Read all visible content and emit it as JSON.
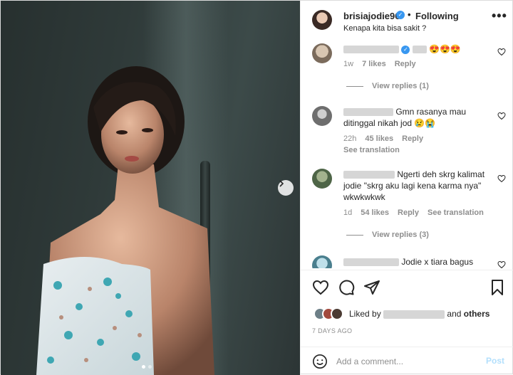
{
  "post": {
    "author": "brisiajodie96",
    "follow_state": "Following",
    "separator": "•",
    "more_glyph": "•••",
    "caption": "Kenapa kita bisa sakit ?"
  },
  "comments": [
    {
      "text_emoji": "😍😍😍",
      "age": "1w",
      "likes": "7 likes",
      "reply": "Reply",
      "view_replies": "View replies (1)"
    },
    {
      "text": "Gmn rasanya mau ditinggal nikah jod",
      "text_emoji": "😢😭",
      "age": "22h",
      "likes": "45 likes",
      "reply": "Reply",
      "see_translation": "See translation"
    },
    {
      "text": "Ngerti deh skrg kalimat jodie \"skrg aku lagi kena karma nya\" wkwkwkwk",
      "age": "1d",
      "likes": "54 likes",
      "reply": "Reply",
      "see_translation": "See translation",
      "view_replies": "View replies (3)"
    },
    {
      "text": "Jodie x tiara bagus"
    }
  ],
  "likes_summary": {
    "prefix": "Liked by",
    "conjunction": "and",
    "others": "others"
  },
  "date": "7 DAYS AGO",
  "add_comment": {
    "placeholder": "Add a comment...",
    "post_label": "Post"
  },
  "icons": {
    "verified": "verified-badge-icon",
    "next": "chevron-right-icon",
    "like": "heart-icon",
    "comment": "comment-bubble-icon",
    "share": "paper-plane-icon",
    "save": "bookmark-icon",
    "emoji": "smiley-icon"
  },
  "colors": {
    "verified": "#3897f0",
    "post_disabled": "#b2dffc",
    "muted": "#8e8e8e",
    "text": "#262626"
  },
  "carousel": {
    "total": 2,
    "current": 1
  }
}
